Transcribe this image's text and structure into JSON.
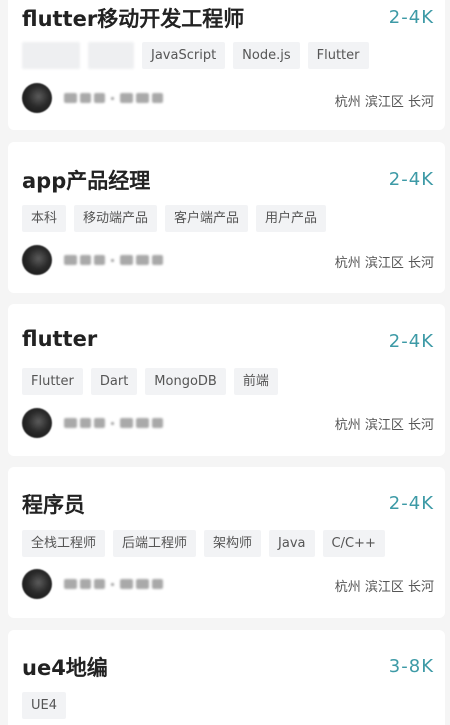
{
  "jobs": [
    {
      "title": "flutter移动开发工程师",
      "salary": "2-4K",
      "tags": [
        "JavaScript",
        "Node.js",
        "Flutter"
      ],
      "location": "杭州 滨江区 长河"
    },
    {
      "title": "app产品经理",
      "salary": "2-4K",
      "tags": [
        "本科",
        "移动端产品",
        "客户端产品",
        "用户产品"
      ],
      "location": "杭州 滨江区 长河"
    },
    {
      "title": "flutter",
      "salary": "2-4K",
      "tags": [
        "Flutter",
        "Dart",
        "MongoDB",
        "前端"
      ],
      "location": "杭州 滨江区 长河"
    },
    {
      "title": "程序员",
      "salary": "2-4K",
      "tags": [
        "全栈工程师",
        "后端工程师",
        "架构师",
        "Java",
        "C/C++"
      ],
      "location": "杭州 滨江区 长河"
    },
    {
      "title": "ue4地编",
      "salary": "3-8K",
      "tags": [
        "UE4"
      ]
    }
  ]
}
